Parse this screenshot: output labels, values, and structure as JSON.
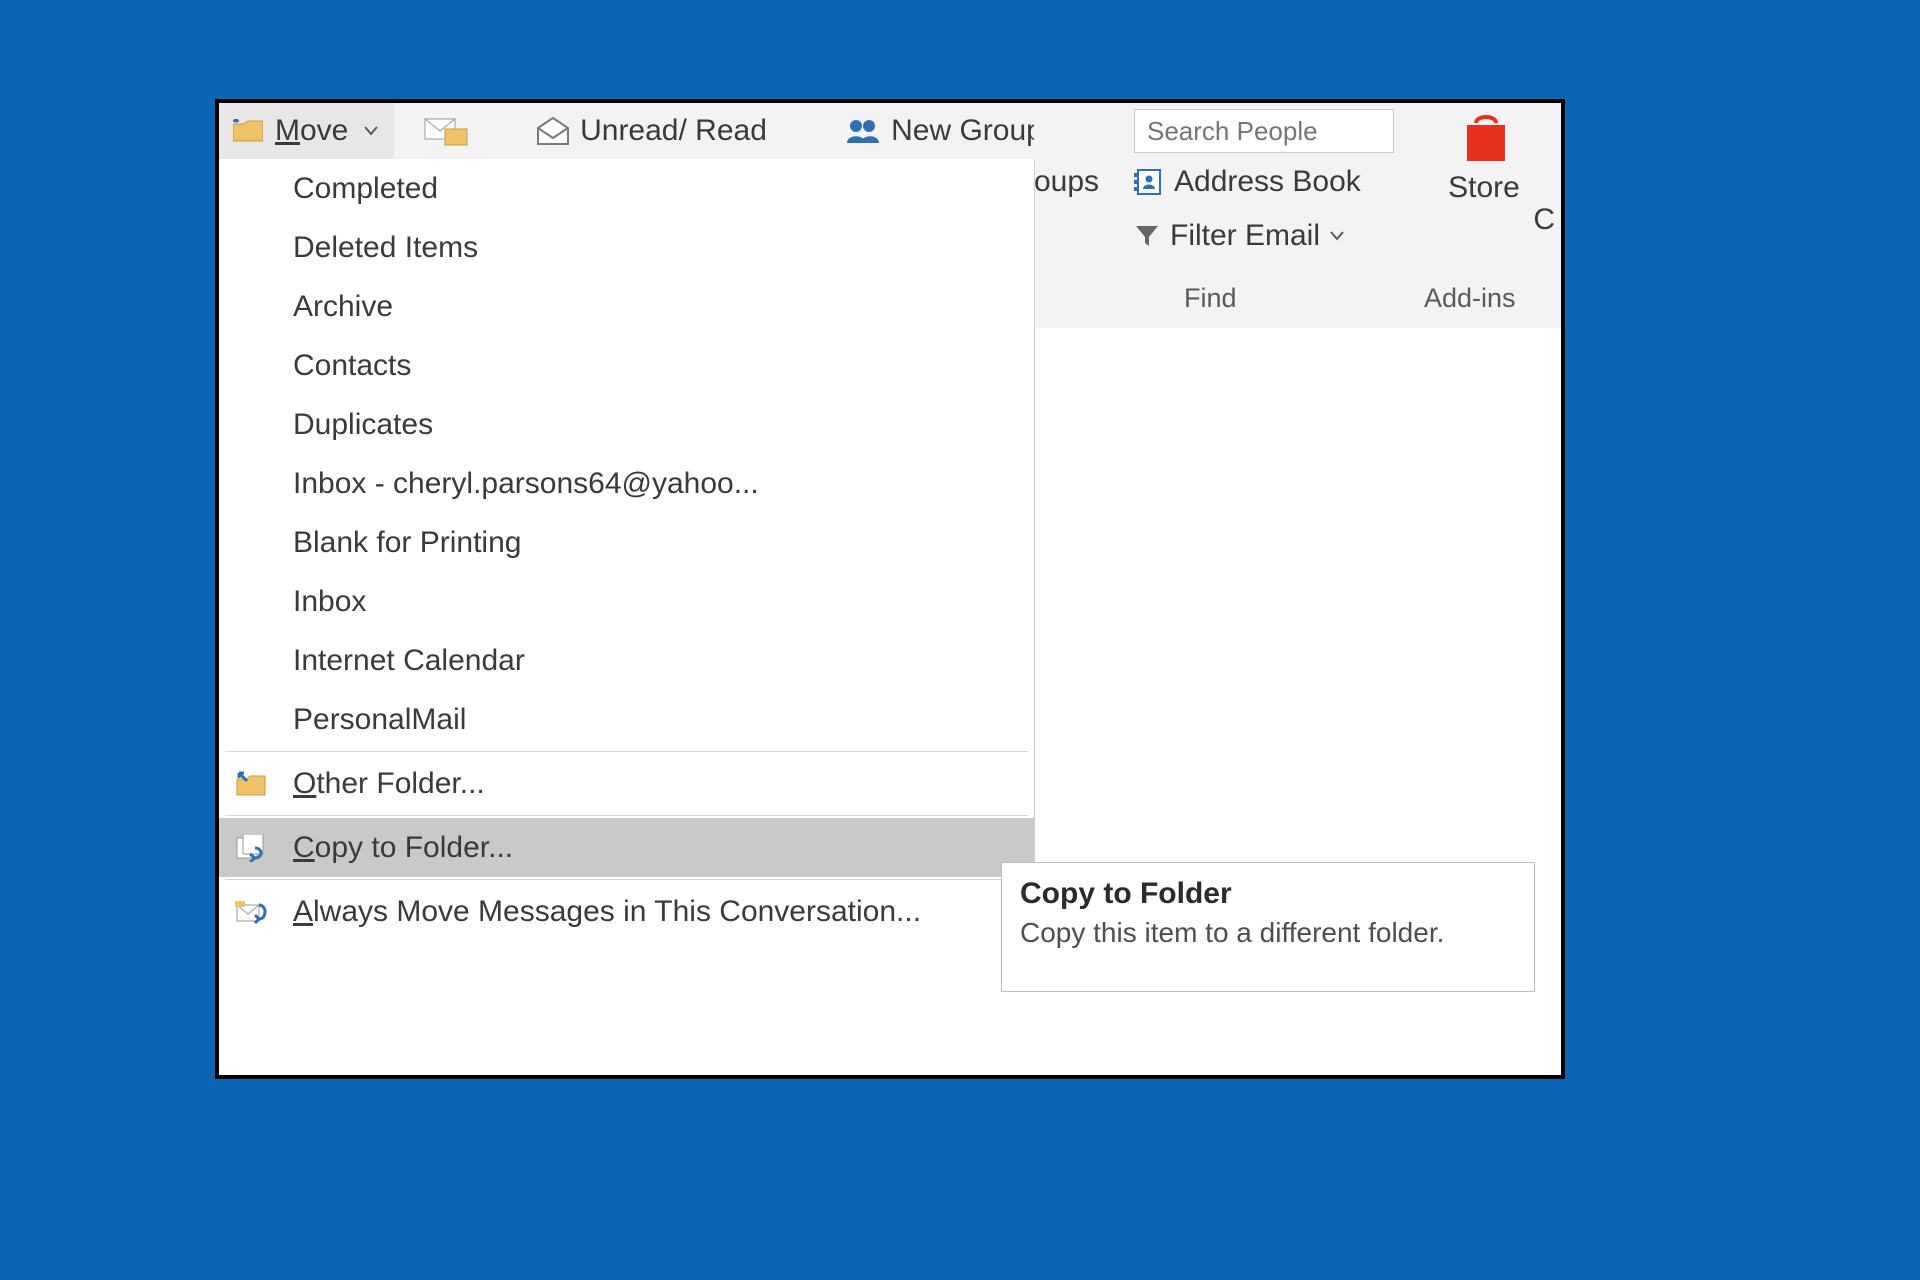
{
  "ribbon": {
    "move_label": "Move",
    "unread_read_label": "Unread/ Read",
    "new_group_label": "New Group",
    "groups_fragment": "oups",
    "search_people_placeholder": "Search People",
    "address_book_label": "Address Book",
    "filter_email_label": "Filter Email",
    "find_group_label": "Find",
    "store_label": "Store",
    "addins_group_label": "Add-ins",
    "right_edge_fragment": "C"
  },
  "move_menu": {
    "folders": [
      "Completed",
      "Deleted Items",
      "Archive",
      "Contacts",
      "Duplicates",
      "Inbox - cheryl.parsons64@yahoo...",
      "Blank for Printing",
      "Inbox",
      "Internet Calendar",
      "PersonalMail"
    ],
    "other_folder_label": "Other Folder...",
    "copy_to_folder_label": "Copy to Folder...",
    "always_move_label": "Always Move Messages in This Conversation..."
  },
  "tooltip": {
    "title": "Copy to Folder",
    "body": "Copy this item to a different folder."
  }
}
